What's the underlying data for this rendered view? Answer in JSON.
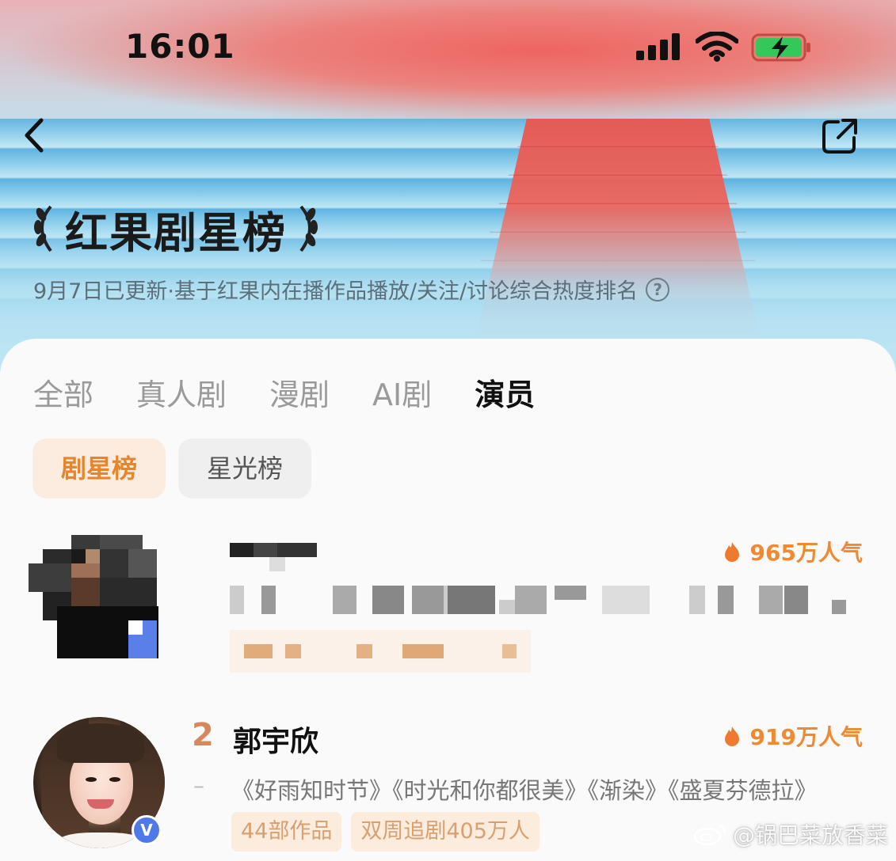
{
  "status_bar": {
    "time": "16:01"
  },
  "header": {
    "title": "红果剧星榜",
    "subtitle": "9月7日已更新·基于红果内在播作品播放/关注/讨论综合热度排名"
  },
  "tabs": [
    {
      "label": "全部",
      "active": false
    },
    {
      "label": "真人剧",
      "active": false
    },
    {
      "label": "漫剧",
      "active": false
    },
    {
      "label": "AI剧",
      "active": false
    },
    {
      "label": "演员",
      "active": true
    }
  ],
  "subtabs": [
    {
      "label": "剧星榜",
      "active": true
    },
    {
      "label": "星光榜",
      "active": false
    }
  ],
  "ranking": [
    {
      "rank": "",
      "name": "",
      "heat": "965万人气",
      "trend": "",
      "works": "",
      "tags": []
    },
    {
      "rank": "2",
      "name": "郭宇欣",
      "heat": "919万人气",
      "trend": "–",
      "works": "《好雨知时节》《时光和你都很美》《渐染》《盛夏芬德拉》",
      "tags": [
        "44部作品",
        "双周追剧405万人"
      ],
      "verified_badge": "V"
    }
  ],
  "watermark": "@锅巴菜放香菜",
  "colors": {
    "accent": "#e5852d",
    "heat": "#ef8a33",
    "tag_bg": "#fbecdd",
    "verified": "#4f78e8"
  }
}
